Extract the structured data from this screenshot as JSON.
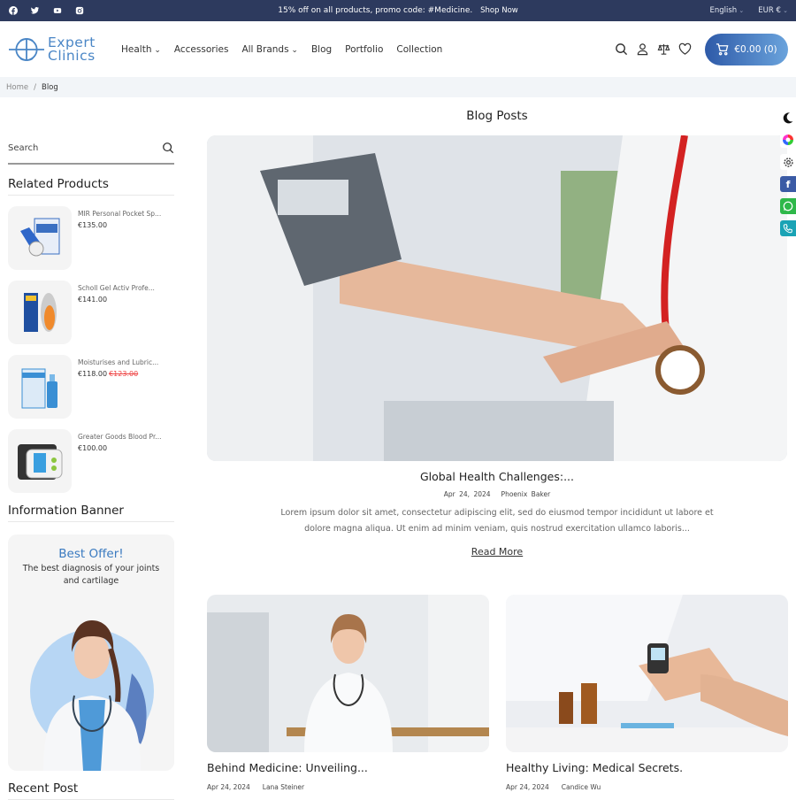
{
  "topbar": {
    "social": [
      "facebook-icon",
      "twitter-icon",
      "youtube-icon",
      "instagram-icon"
    ],
    "promo": "15% off on all products, promo code: #Medicine.",
    "shop_now": "Shop Now",
    "language": "English",
    "currency": "EUR €"
  },
  "header": {
    "logo_line1": "Expert",
    "logo_line2": "Clinics",
    "nav": [
      "Health",
      "Accessories",
      "All Brands",
      "Blog",
      "Portfolio",
      "Collection"
    ],
    "cart_label": "€0.00 (0)",
    "brand_color": "#2e5aa8"
  },
  "breadcrumb": {
    "home": "Home",
    "sep": "/",
    "current": "Blog"
  },
  "sidebar": {
    "search_placeholder": "Search",
    "related_title": "Related Products",
    "products": [
      {
        "name": "MIR Personal Pocket Sp...",
        "price": "€135.00",
        "old_price": ""
      },
      {
        "name": "Scholl Gel Activ Profe...",
        "price": "€141.00",
        "old_price": ""
      },
      {
        "name": "Moisturises and Lubric...",
        "price": "€118.00",
        "old_price": "€123.00"
      },
      {
        "name": "Greater Goods Blood Pr...",
        "price": "€100.00",
        "old_price": ""
      }
    ],
    "banner_title": "Information Banner",
    "banner_heading": "Best Offer!",
    "banner_text": "The best diagnosis of your joints and cartilage",
    "recent_title": "Recent Post"
  },
  "main": {
    "title": "Blog Posts",
    "featured": {
      "title": "Global Health Challenges:...",
      "date": "Apr 24, 2024",
      "author": "Phoenix Baker",
      "excerpt": "Lorem ipsum dolor sit amet, consectetur adipiscing elit, sed do eiusmod tempor incididunt ut labore et dolore magna aliqua. Ut enim ad minim veniam, quis nostrud exercitation ullamco laboris...",
      "read_more": "Read More"
    },
    "posts": [
      {
        "title": "Behind Medicine: Unveiling...",
        "date": "Apr 24, 2024",
        "author": "Lana Steiner"
      },
      {
        "title": "Healthy Living: Medical Secrets.",
        "date": "Apr 24, 2024",
        "author": "Candice Wu"
      }
    ]
  },
  "floaters": [
    "moon-icon",
    "color-wheel-icon",
    "gear-icon",
    "facebook-icon",
    "whatsapp-icon",
    "phone-icon"
  ]
}
